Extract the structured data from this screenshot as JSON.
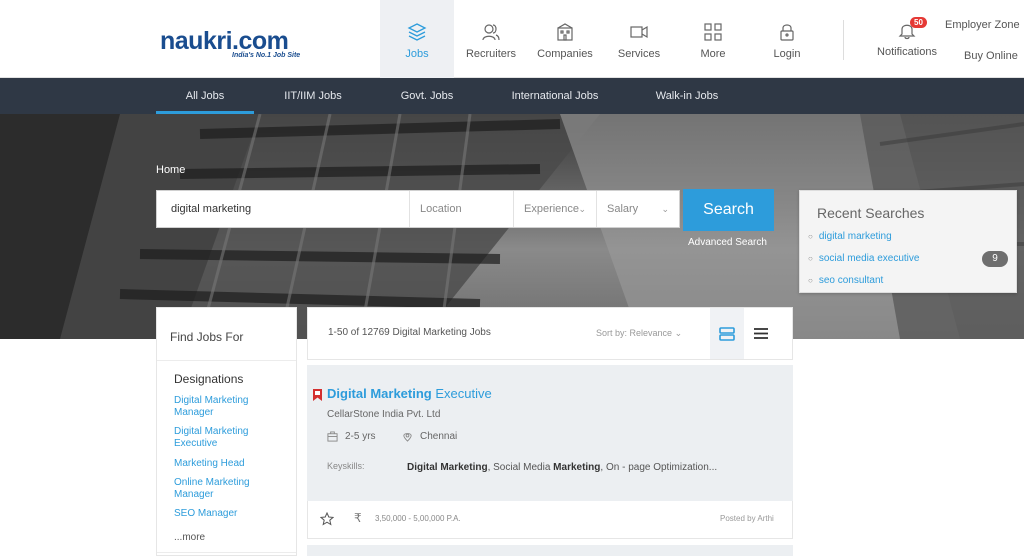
{
  "logo": {
    "brand": "naukri.com",
    "tagline": "India's No.1 Job Site"
  },
  "nav": [
    {
      "label": "Jobs",
      "icon": "layers-icon",
      "active": true
    },
    {
      "label": "Recruiters",
      "icon": "users-icon"
    },
    {
      "label": "Companies",
      "icon": "building-icon"
    },
    {
      "label": "Services",
      "icon": "video-icon"
    },
    {
      "label": "More",
      "icon": "grid-icon"
    },
    {
      "label": "Login",
      "icon": "lock-icon"
    }
  ],
  "notifications": {
    "label": "Notifications",
    "count": "50"
  },
  "employer_zone": "Employer Zone",
  "buy_online": "Buy Online",
  "subnav": [
    "All Jobs",
    "IIT/IIM Jobs",
    "Govt. Jobs",
    "International Jobs",
    "Walk-in Jobs"
  ],
  "breadcrumb": "Home",
  "search": {
    "keyword": "digital marketing",
    "location_placeholder": "Location",
    "experience_placeholder": "Experience",
    "salary_placeholder": "Salary",
    "button": "Search",
    "advanced": "Advanced Search"
  },
  "recent_searches": {
    "title": "Recent Searches",
    "items": [
      "digital marketing",
      "social media executive",
      "seo consultant"
    ],
    "count": "9"
  },
  "find_jobs": {
    "title": "Find Jobs For",
    "heading": "Designations",
    "links": [
      "Digital Marketing Manager",
      "Digital Marketing Executive",
      "Marketing Head",
      "Online Marketing Manager",
      "SEO Manager"
    ],
    "more": "...more"
  },
  "results": {
    "count_text": "1-50 of 12769 Digital Marketing Jobs",
    "sort": "Sort by: Relevance"
  },
  "job": {
    "title_bold": "Digital Marketing",
    "title_rest": " Executive",
    "company": "CellarStone India Pvt. Ltd",
    "experience": "2-5 yrs",
    "location": "Chennai",
    "keyskills_label": "Keyskills:",
    "keyskills": [
      {
        "text": "Digital Marketing",
        "bold": true
      },
      {
        "text": ", Social Media ",
        "bold": false
      },
      {
        "text": "Marketing",
        "bold": true
      },
      {
        "text": ", On - page Optimization...",
        "bold": false
      }
    ],
    "salary_symbol": "₹",
    "salary": "3,50,000 - 5,00,000 P.A.",
    "posted_by": "Posted by Arthi"
  },
  "colors": {
    "accent": "#2d9cdb",
    "subnav_bg": "#2f3845",
    "badge": "#e53935"
  }
}
